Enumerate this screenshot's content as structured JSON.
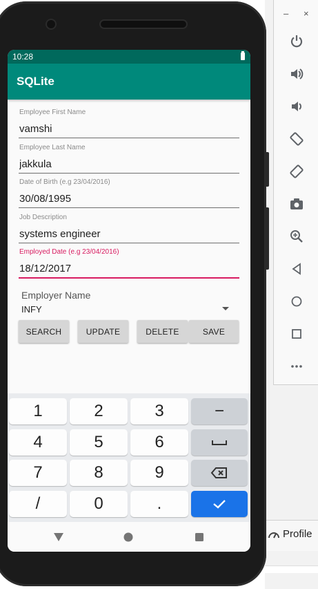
{
  "status_bar": {
    "time": "10:28"
  },
  "app_bar": {
    "title": "SQLite"
  },
  "form": {
    "first_name": {
      "label": "Employee First Name",
      "value": "vamshi"
    },
    "last_name": {
      "label": "Employee Last Name",
      "value": "jakkula"
    },
    "dob": {
      "label": "Date of Birth (e.g 23/04/2016)",
      "value": "30/08/1995"
    },
    "job": {
      "label": "Job Description",
      "value": "systems engineer"
    },
    "employed": {
      "label": "Employed Date (e.g 23/04/2016)",
      "value": "18/12/2017"
    },
    "employer": {
      "label": "Employer Name",
      "value": "INFY"
    }
  },
  "buttons": {
    "search": "SEARCH",
    "update": "UPDATE",
    "delete": "DELETE",
    "save": "SAVE"
  },
  "keyboard": {
    "row1": [
      "1",
      "2",
      "3",
      "−"
    ],
    "row2": [
      "4",
      "5",
      "6"
    ],
    "row3": [
      "7",
      "8",
      "9"
    ],
    "row4": [
      "/",
      "0",
      "."
    ]
  },
  "emulator_panel": {
    "minimize": "–",
    "close": "×",
    "tools": [
      "power-icon",
      "volume-up-icon",
      "volume-down-icon",
      "rotate-left-icon",
      "rotate-right-icon",
      "camera-icon",
      "zoom-icon",
      "back-icon",
      "home-icon",
      "overview-icon",
      "more-icon"
    ]
  },
  "background": {
    "profiler_label": "Profile"
  },
  "colors": {
    "primary": "#00897b",
    "primary_dark": "#00695c",
    "accent": "#d81b60",
    "enter_key": "#1a73e8"
  }
}
